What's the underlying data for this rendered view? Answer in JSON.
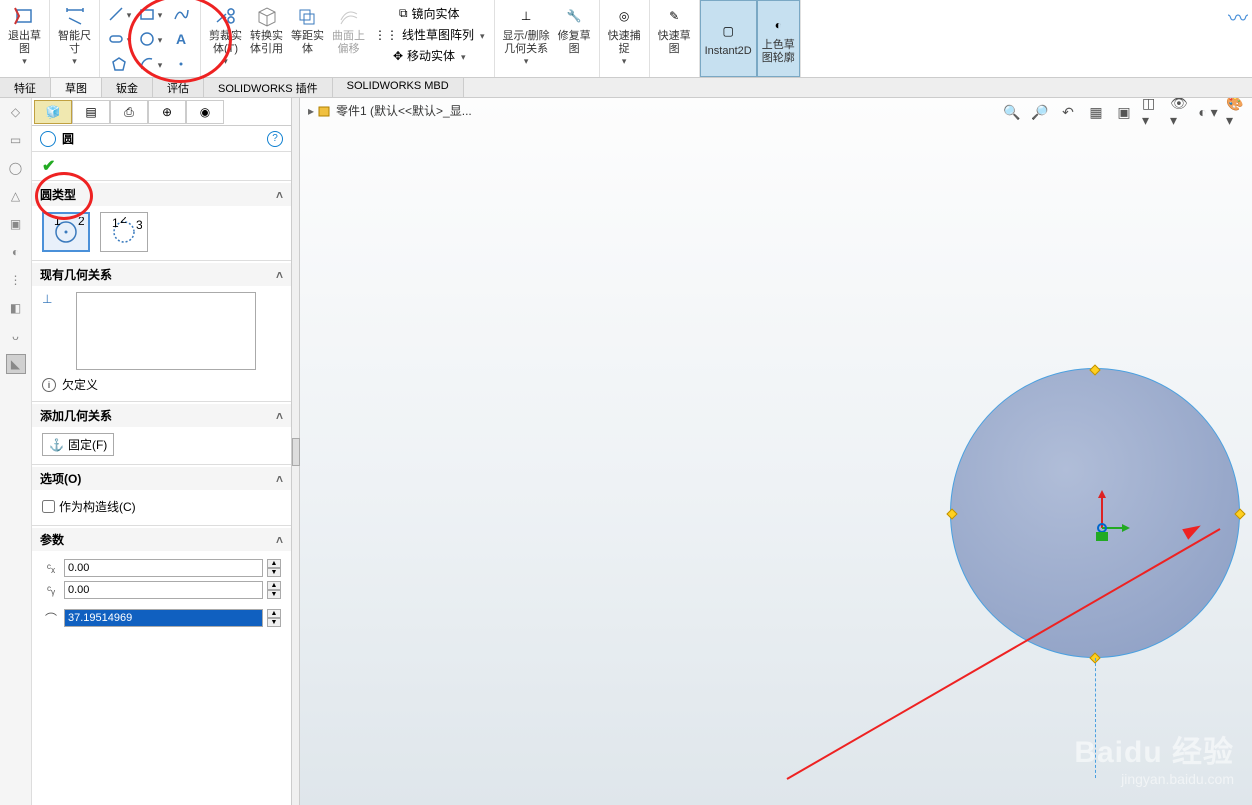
{
  "ribbon": {
    "exit_sketch": "退出草\n图",
    "smart_dim": "智能尺\n寸",
    "trim": "剪裁实\n体(T)",
    "convert": "转换实\n体引用",
    "offset": "等距实\n体",
    "curve_offset": "曲面上\n偏移",
    "mirror": "镜向实体",
    "linear_pattern": "线性草图阵列",
    "move": "移动实体",
    "show_rel": "显示/删除\n几何关系",
    "repair": "修复草\n图",
    "quick_snap": "快速捕\n捉",
    "quick_sketch": "快速草\n图",
    "instant2d": "Instant2D",
    "shaded": "上色草\n图轮廓"
  },
  "tabs": {
    "feature": "特征",
    "sketch": "草图",
    "sheetmetal": "钣金",
    "evaluate": "评估",
    "sw_plugin": "SOLIDWORKS 插件",
    "sw_mbd": "SOLIDWORKS MBD"
  },
  "pm": {
    "title": "圆",
    "sec_type": "圆类型",
    "sec_exist_rel": "现有几何关系",
    "underdefined": "欠定义",
    "sec_add_rel": "添加几何关系",
    "fix": "固定(F)",
    "sec_options": "选项(O)",
    "construction": "作为构造线(C)",
    "sec_params": "参数",
    "cx": "0.00",
    "cy": "0.00",
    "radius": "37.19514969"
  },
  "crumb": {
    "part": "零件1  (默认<<默认>_显..."
  },
  "watermark": {
    "l1": "Baidu 经验",
    "l2": "jingyan.baidu.com"
  }
}
